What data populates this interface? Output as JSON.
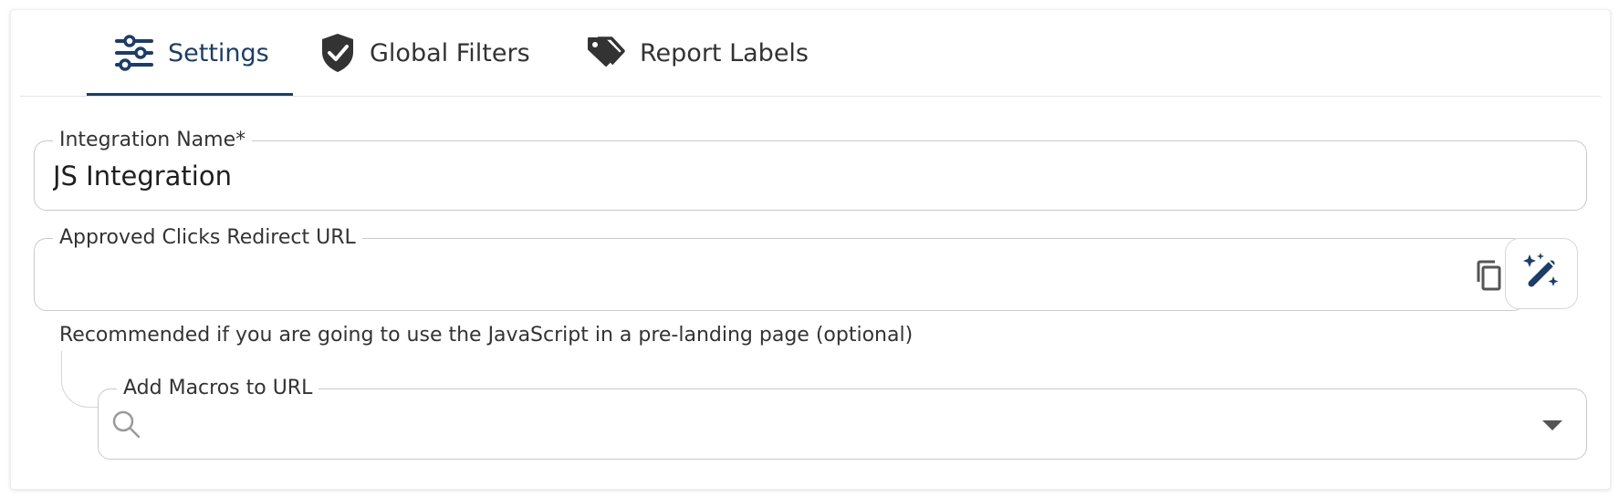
{
  "tabs": [
    {
      "label": "Settings",
      "icon": "sliders-icon",
      "active": true
    },
    {
      "label": "Global Filters",
      "icon": "shield-check-icon",
      "active": false
    },
    {
      "label": "Report Labels",
      "icon": "tags-icon",
      "active": false
    }
  ],
  "form": {
    "integration_name": {
      "label": "Integration Name",
      "required_marker": "*",
      "value": "JS Integration"
    },
    "redirect_url": {
      "label": "Approved Clicks Redirect URL",
      "value": "",
      "copy_icon": "copy-icon",
      "magic_icon": "magic-wand-icon"
    },
    "helper_text": "Recommended if you are going to use the JavaScript in a pre-landing page (optional)",
    "macros": {
      "label": "Add Macros to URL",
      "value": "",
      "search_icon": "search-icon",
      "dropdown_icon": "caret-down-icon"
    }
  },
  "colors": {
    "accent": "#1c3d66",
    "border": "#c9c9c9",
    "icon_dark": "#333333"
  }
}
